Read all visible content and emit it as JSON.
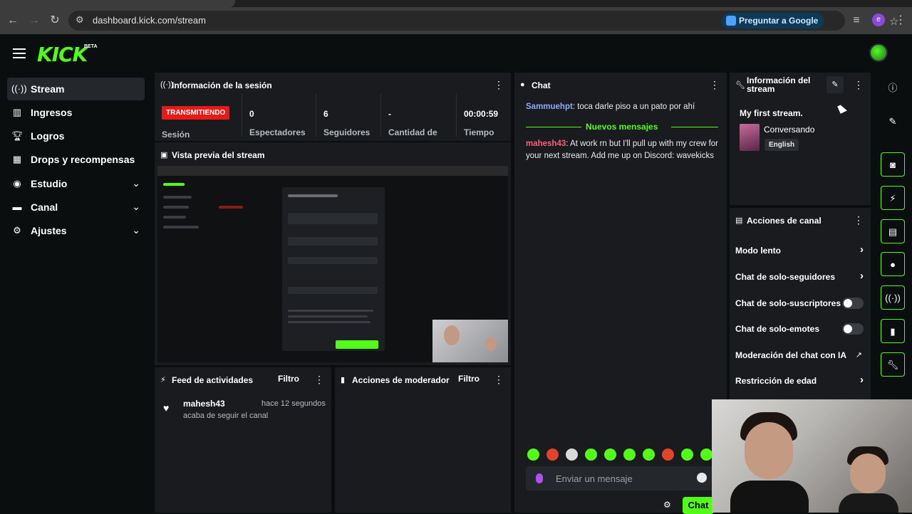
{
  "browser": {
    "url": "dashboard.kick.com/stream",
    "google_button": "Preguntar a Google",
    "profile_initial": "e"
  },
  "app": {
    "logo": "KICK",
    "beta": "BETA",
    "accent": "#53fc18"
  },
  "sidebar": {
    "items": [
      {
        "label": "Stream",
        "icon": "broadcast-icon",
        "active": true
      },
      {
        "label": "Ingresos",
        "icon": "chart-icon"
      },
      {
        "label": "Logros",
        "icon": "trophy-icon"
      },
      {
        "label": "Drops y recompensas",
        "icon": "gift-icon"
      },
      {
        "label": "Estudio",
        "icon": "studio-icon",
        "expandable": true
      },
      {
        "label": "Canal",
        "icon": "channel-icon",
        "expandable": true
      },
      {
        "label": "Ajustes",
        "icon": "gear-icon",
        "expandable": true
      }
    ]
  },
  "session": {
    "title": "Información de la sesión",
    "live_badge": "TRANSMITIENDO",
    "session_label": "Sesión",
    "stats": [
      {
        "value": "0",
        "label": "Espectadores"
      },
      {
        "value": "6",
        "label": "Seguidores"
      },
      {
        "value": "-",
        "label": "Cantidad de"
      },
      {
        "value": "00:00:59",
        "label": "Tiempo"
      }
    ]
  },
  "preview": {
    "title": "Vista previa del stream"
  },
  "feed": {
    "title": "Feed de actividades",
    "filter": "Filtro",
    "items": [
      {
        "name": "mahesh43",
        "time": "hace 12 segundos",
        "desc": "acaba de seguir el canal"
      }
    ]
  },
  "mod_actions": {
    "title": "Acciones de moderador",
    "filter": "Filtro"
  },
  "chat": {
    "title": "Chat",
    "messages": [
      {
        "user": "Sammuehpt",
        "user_color": "#8fa9ff",
        "text": "toca darle piso a un pato por ahí"
      },
      {
        "user": "mahesh43",
        "user_color": "#ff5e7a",
        "text": "At work rn but I'll pull up with my crew for your next stream. Add me up on Discord:  wavekicks"
      }
    ],
    "new_messages": "Nuevos mensajes",
    "input_placeholder": "Enviar un mensaje",
    "send": "Chat"
  },
  "stream_info": {
    "title": "Información del stream",
    "stream_title": "My first stream.",
    "category": "Conversando",
    "tag": "English"
  },
  "channel_actions": {
    "title": "Acciones de canal",
    "items": [
      {
        "label": "Modo lento",
        "control": "chevron"
      },
      {
        "label": "Chat de solo-seguidores",
        "control": "chevron"
      },
      {
        "label": "Chat de solo-suscriptores",
        "control": "toggle"
      },
      {
        "label": "Chat de solo-emotes",
        "control": "toggle"
      },
      {
        "label": "Moderación del chat con IA",
        "control": "external"
      },
      {
        "label": "Restricción de edad",
        "control": "chevron"
      }
    ]
  }
}
